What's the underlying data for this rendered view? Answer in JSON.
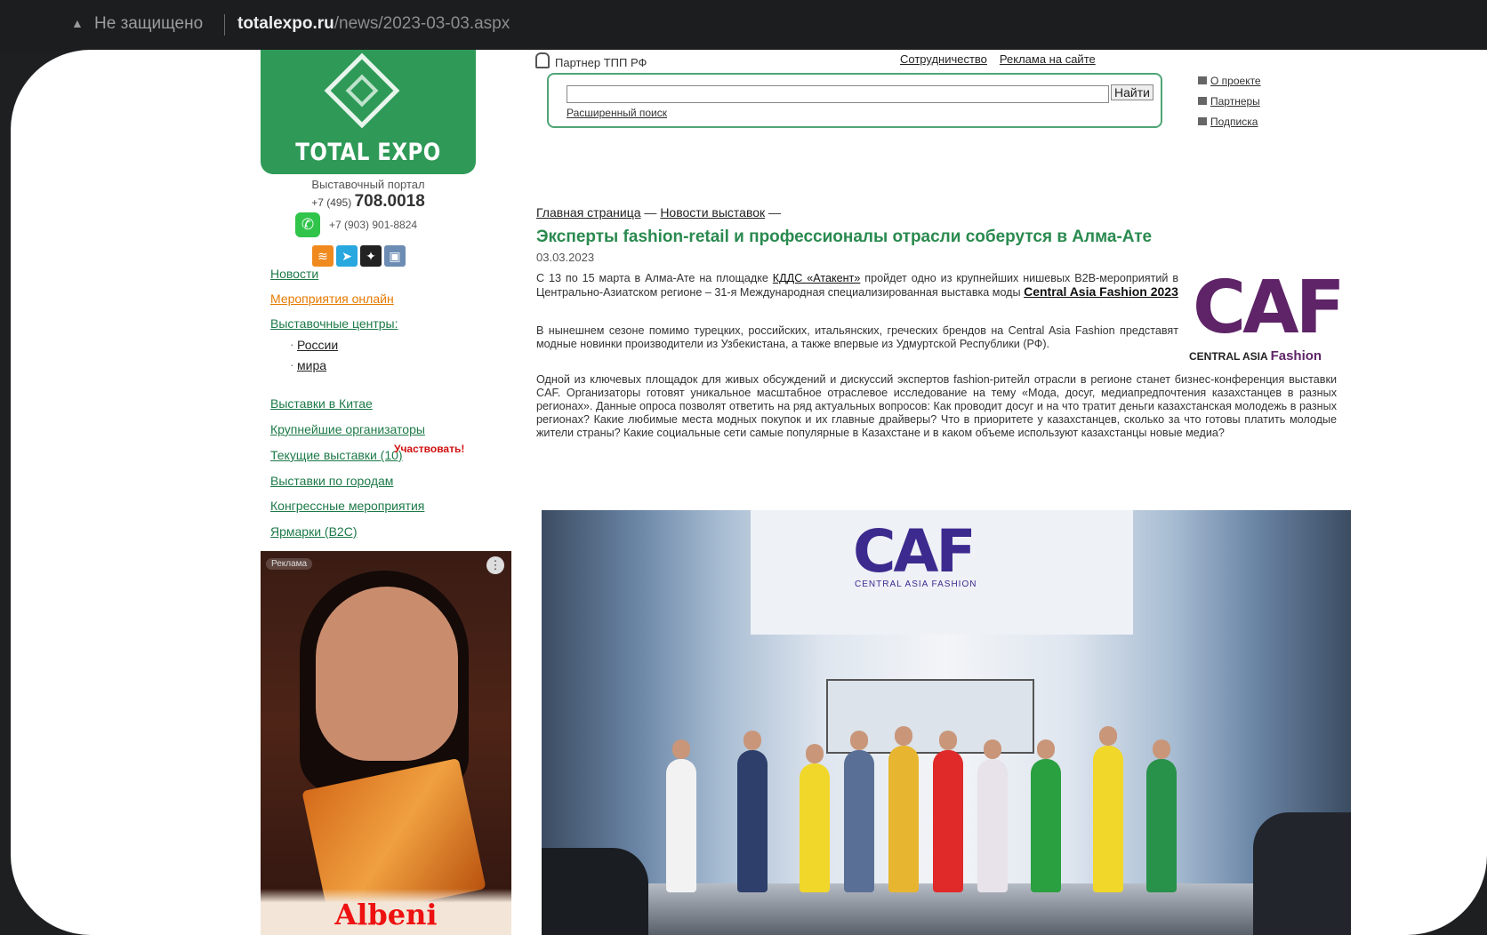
{
  "browser": {
    "security_label": "Не защищено",
    "url_host": "totalexpo.ru",
    "url_path": "/news/2023-03-03.aspx"
  },
  "logo": {
    "text": "TOTAL EXPO"
  },
  "contacts": {
    "portal": "Выставочный портал",
    "phone_prefix": "+7 (495)",
    "phone_main": "708.0018",
    "phone_whatsapp": "+7 (903) 901-8824"
  },
  "header": {
    "partner": "Партнер ТПП РФ",
    "links": [
      "Сотрудничество",
      "Реклама на сайте"
    ],
    "search_button": "Найти",
    "advanced_search": "Расширенный поиск",
    "right_links": [
      "О проекте",
      "Партнеры",
      "Подписка"
    ]
  },
  "leftnav": {
    "items": [
      {
        "label": "Новости"
      },
      {
        "label": "Мероприятия онлайн"
      },
      {
        "label": "Выставочные центры:"
      },
      {
        "label": "России"
      },
      {
        "label": "мира"
      },
      {
        "label": "Выставки в Китае"
      },
      {
        "label": "Крупнейшие организаторы"
      },
      {
        "label": "Текущие выставки (10)"
      },
      {
        "label": "Выставки по городам"
      },
      {
        "label": "Конгрессные мероприятия"
      },
      {
        "label": "Ярмарки (B2C)"
      }
    ],
    "participate": "Участвовать!"
  },
  "ad": {
    "label": "Реклама",
    "brand": "Albeni"
  },
  "article": {
    "breadcrumb": [
      "Главная страница",
      "Новости выставок"
    ],
    "title": "Эксперты fashion-retail и профессионалы отрасли соберутся в Алма-Ате",
    "date": "03.03.2023",
    "p1_a": "С 13 по 15 марта в Алма-Ате на площадке ",
    "p1_link1": "КДДС «Атакент»",
    "p1_b": " пройдет одно из крупнейших нишевых B2B-мероприятий в Центрально-Азиатском регионе – 31-я Международная специализированная выставка моды ",
    "p1_link2": "Central Asia Fashion 2023",
    "p2": "В нынешнем сезоне помимо турецких, российских, итальянских, греческих брендов на Central Asia Fashion представят модные новинки производители из Узбекистана, а также впервые из Удмуртской Республики (РФ).",
    "p3": "Одной из ключевых площадок для живых обсуждений и дискуссий экспертов fashion-ритейл отрасли в регионе станет бизнес-конференция выставки CAF. Организаторы готовят уникальное масштабное отраслевое исследование на тему «Мода, досуг, медиапредпочтения казахстанцев в разных регионах». Данные опроса позволят ответить на ряд актуальных вопросов: Как проводит досуг и на что тратит деньги казахстанская молодежь в разных регионах? Какие любимые места модных покупок и их главные драйверы? Что в приоритете у казахстанцев, сколько за что готовы платить молодые жители страны? Какие социальные сети самые популярные в Казахстане и в каком объеме используют казахстанцы новые медиа?",
    "caf_logo": "CAF",
    "caf_sub": "CENTRAL ASIA",
    "caf_sub2": "Fashion",
    "photo_logo": "CAF",
    "photo_logo_sub": "CENTRAL ASIA FASHION"
  }
}
